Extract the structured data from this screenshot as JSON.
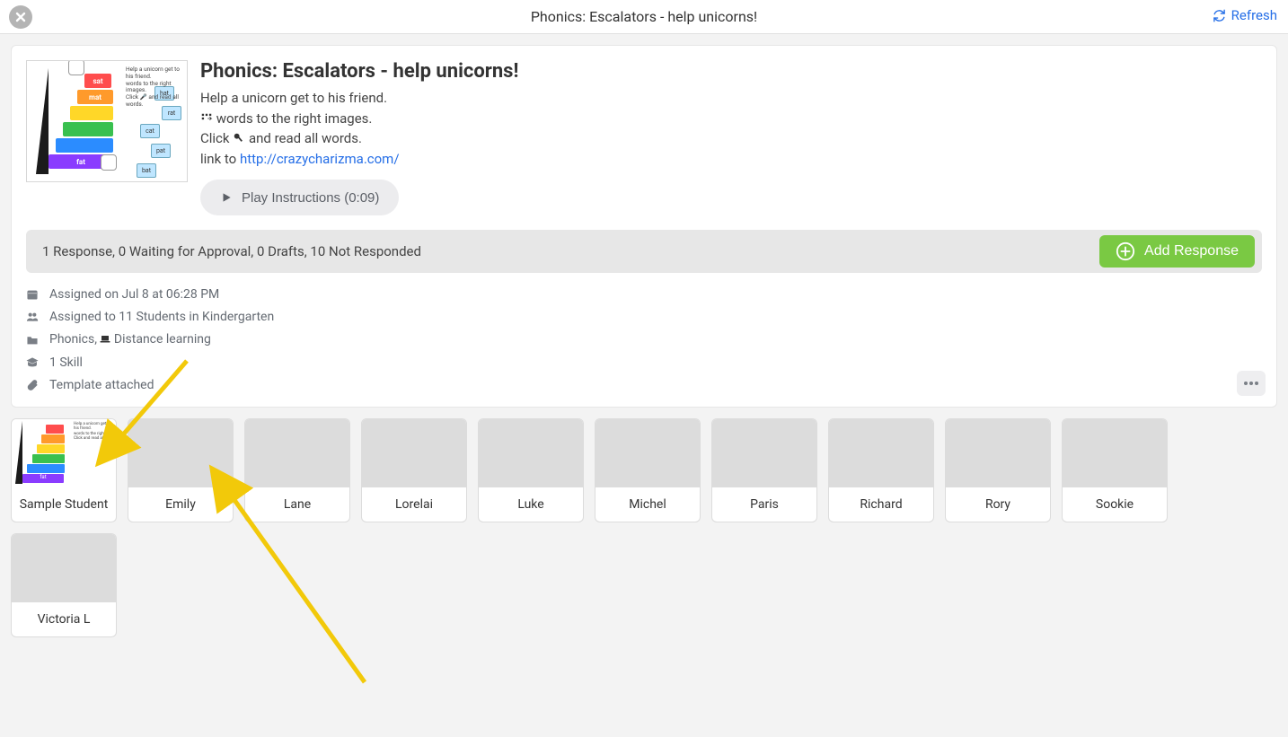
{
  "header": {
    "title": "Phonics: Escalators - help unicorns!",
    "refresh_label": "Refresh"
  },
  "activity": {
    "title": "Phonics: Escalators - help unicorns!",
    "desc_line1": "Help a unicorn get to his friend.",
    "desc_line2_suffix": " words to the right images.",
    "desc_line3_prefix": "Click ",
    "desc_line3_suffix": " and read all words.",
    "desc_line4_prefix": "link to ",
    "desc_link": "http://crazycharizma.com/",
    "play_label": "Play Instructions (0:09)"
  },
  "status": {
    "text": "1 Response, 0 Waiting for Approval, 0 Drafts, 10 Not Responded",
    "add_label": "Add Response"
  },
  "meta": {
    "assigned_on": "Assigned on Jul 8 at 06:28 PM",
    "assigned_to": "Assigned to 11 Students in Kindergarten",
    "folders_prefix": "Phonics, ",
    "folders_suffix": " Distance learning",
    "skills": "1 Skill",
    "template": "Template attached"
  },
  "students": [
    {
      "name": "Sample Student",
      "has_thumb": true
    },
    {
      "name": "Emily",
      "has_thumb": false
    },
    {
      "name": "Lane",
      "has_thumb": false
    },
    {
      "name": "Lorelai",
      "has_thumb": false
    },
    {
      "name": "Luke",
      "has_thumb": false
    },
    {
      "name": "Michel",
      "has_thumb": false
    },
    {
      "name": "Paris",
      "has_thumb": false
    },
    {
      "name": "Richard",
      "has_thumb": false
    },
    {
      "name": "Rory",
      "has_thumb": false
    },
    {
      "name": "Sookie",
      "has_thumb": false
    },
    {
      "name": "Victoria L",
      "has_thumb": false
    }
  ]
}
